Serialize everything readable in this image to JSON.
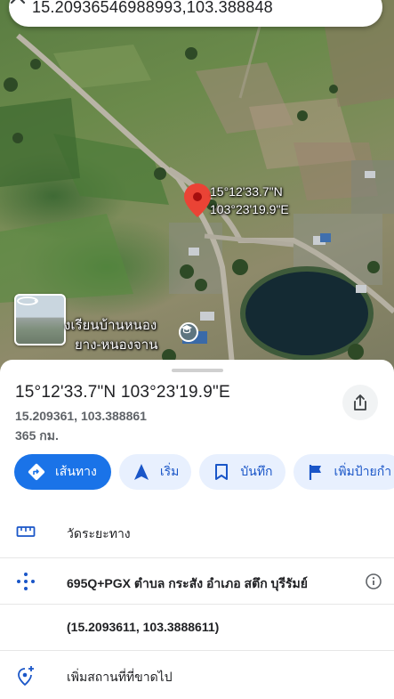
{
  "search": {
    "value": "15.20936546988993,103.388848",
    "close_icon": "close-icon"
  },
  "map": {
    "pin_label_line1": "15°12'33.7\"N",
    "pin_label_line2": "103°23'19.9\"E",
    "school_label_line1": "งเรียนบ้านหนอง",
    "school_label_line2": "ยาง-หนองจาน",
    "pin_color": "#ea4335"
  },
  "place": {
    "title": "15°12'33.7\"N 103°23'19.9\"E",
    "decimal": "15.209361, 103.388861",
    "distance": "365 กม."
  },
  "actions": [
    {
      "label": "เส้นทาง",
      "icon": "directions-icon"
    },
    {
      "label": "เริ่ม",
      "icon": "navigation-arrow-icon"
    },
    {
      "label": "บันทึก",
      "icon": "bookmark-icon"
    },
    {
      "label": "เพิ่มป้ายกำ",
      "icon": "flag-icon"
    }
  ],
  "rows": {
    "measure": "วัดระยะทาง",
    "plus_code": "695Q+PGX ตำบล กระสัง อำเภอ สตึก บุรีรัมย์",
    "coords": "(15.2093611, 103.3888611)",
    "add_place": "เพิ่มสถานที่ที่ขาดไป"
  },
  "colors": {
    "accent": "#1a73e8",
    "chip_bg": "#e8f0fe",
    "chip_text": "#1a56c8"
  }
}
